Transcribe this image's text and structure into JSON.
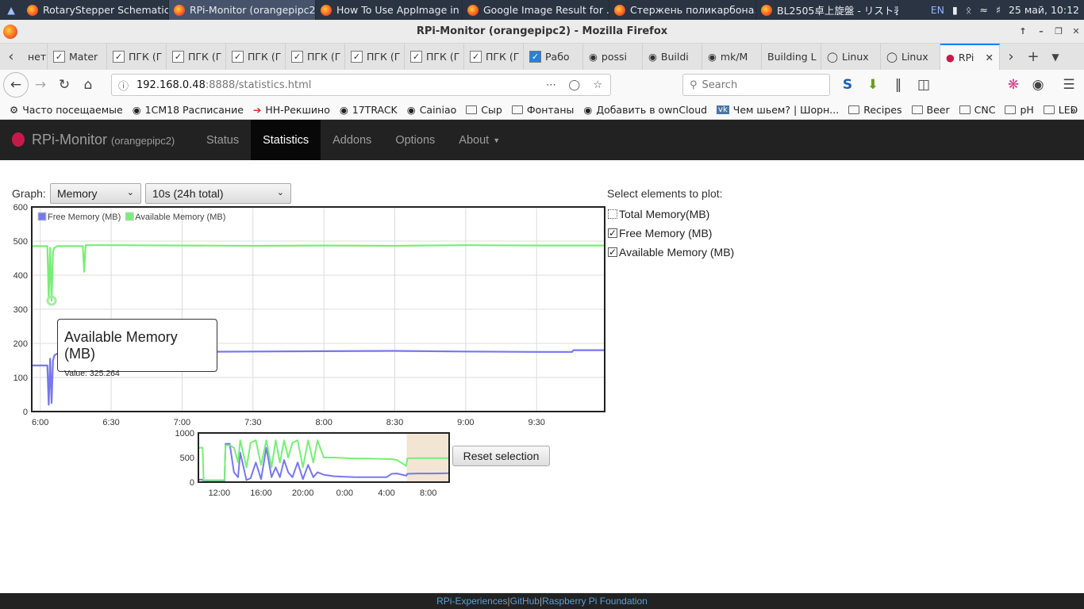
{
  "taskbar": {
    "tasks": [
      {
        "label": "RotaryStepper Schematic...."
      },
      {
        "label": "RPi-Monitor (orangepipc2..."
      },
      {
        "label": "How To Use AppImage in ..."
      },
      {
        "label": "Google Image Result for ..."
      },
      {
        "label": "Стержень поликарбона..."
      },
      {
        "label": "BL2505卓上旋盤 - リスト表..."
      }
    ],
    "lang": "EN",
    "clock": "25 май, 10:12"
  },
  "window": {
    "title": "RPi-Monitor (orangepipc2) - Mozilla Firefox"
  },
  "tabs": [
    {
      "label": "нет"
    },
    {
      "label": "Mater"
    },
    {
      "label": "ПГК (Г"
    },
    {
      "label": "ПГК (Г"
    },
    {
      "label": "ПГК (Г"
    },
    {
      "label": "ПГК (Г"
    },
    {
      "label": "ПГК (Г"
    },
    {
      "label": "ПГК (Г"
    },
    {
      "label": "ПГК (Г"
    },
    {
      "label": "Рабо"
    },
    {
      "label": "possi"
    },
    {
      "label": "Buildi"
    },
    {
      "label": "mk/M"
    },
    {
      "label": "Building L"
    },
    {
      "label": "Linux"
    },
    {
      "label": "Linux"
    },
    {
      "label": "RPi"
    }
  ],
  "navbar": {
    "url_host": "192.168.0.48",
    "url_rest": ":8888/statistics.html",
    "search_placeholder": "Search"
  },
  "bookmarks": [
    {
      "label": "Часто посещаемые"
    },
    {
      "label": "1CM18 Расписание"
    },
    {
      "label": "НН-Рекшино"
    },
    {
      "label": "17TRACK"
    },
    {
      "label": "Cainiao"
    },
    {
      "label": "Сыр"
    },
    {
      "label": "Фонтаны"
    },
    {
      "label": "Добавить в ownCloud"
    },
    {
      "label": "Чем шьем? | Шорн..."
    },
    {
      "label": "Recipes"
    },
    {
      "label": "Beer"
    },
    {
      "label": "CNC"
    },
    {
      "label": "pH"
    },
    {
      "label": "LED"
    }
  ],
  "app": {
    "brand": "RPi-Monitor",
    "host": "(orangepipc2)",
    "nav": [
      "Status",
      "Statistics",
      "Addons",
      "Options",
      "About"
    ]
  },
  "controls": {
    "graph_label": "Graph:",
    "graph_select": "Memory",
    "interval_select": "10s (24h total)",
    "select_title": "Select elements to plot:",
    "elements": [
      {
        "label": "Total Memory(MB)",
        "checked": false
      },
      {
        "label": "Free Memory (MB)",
        "checked": true
      },
      {
        "label": "Available Memory (MB)",
        "checked": true
      }
    ],
    "reset_label": "Reset selection"
  },
  "tooltip": {
    "title": "Available Memory (MB)",
    "value": "Value: 325.264"
  },
  "chart_data": [
    {
      "type": "line",
      "legend": "top-left",
      "grid": true,
      "xlim": [
        5.94,
        9.98
      ],
      "ylim": [
        0,
        600
      ],
      "yticks": [
        0,
        100,
        200,
        300,
        400,
        500,
        600
      ],
      "xticks": [
        {
          "v": 6.0,
          "label": "6:00"
        },
        {
          "v": 6.5,
          "label": "6:30"
        },
        {
          "v": 7.0,
          "label": "7:00"
        },
        {
          "v": 7.5,
          "label": "7:30"
        },
        {
          "v": 8.0,
          "label": "8:00"
        },
        {
          "v": 8.5,
          "label": "8:30"
        },
        {
          "v": 9.0,
          "label": "9:00"
        },
        {
          "v": 9.5,
          "label": "9:30"
        }
      ],
      "highlight": {
        "series": "Available Memory (MB)",
        "x": 6.08,
        "y": 325.264
      },
      "series": [
        {
          "name": "Free Memory (MB)",
          "color": "#7777ee",
          "x": [
            5.94,
            6.05,
            6.06,
            6.07,
            6.08,
            6.09,
            6.1,
            6.12,
            6.2,
            6.5,
            7.0,
            7.5,
            8.0,
            8.5,
            9.0,
            9.5,
            9.75,
            9.76,
            9.98
          ],
          "y": [
            135,
            135,
            20,
            155,
            25,
            150,
            165,
            170,
            172,
            174,
            175,
            176,
            177,
            178,
            176,
            175,
            175,
            180,
            180
          ]
        },
        {
          "name": "Available Memory (MB)",
          "color": "#77ee77",
          "x": [
            5.94,
            6.05,
            6.06,
            6.07,
            6.08,
            6.09,
            6.1,
            6.12,
            6.3,
            6.31,
            6.32,
            6.5,
            7.0,
            7.5,
            8.0,
            8.5,
            9.0,
            9.5,
            9.98
          ],
          "y": [
            485,
            485,
            330,
            480,
            325,
            470,
            480,
            485,
            485,
            410,
            488,
            488,
            487,
            486,
            487,
            486,
            488,
            487,
            487
          ]
        }
      ]
    },
    {
      "type": "line",
      "grid": false,
      "xlim": [
        10.0,
        34.0
      ],
      "ylim": [
        0,
        1000
      ],
      "yticks": [
        0,
        500,
        1000
      ],
      "xticks": [
        {
          "v": 12,
          "label": "12:00"
        },
        {
          "v": 16,
          "label": "16:00"
        },
        {
          "v": 20,
          "label": "20:00"
        },
        {
          "v": 24,
          "label": "0:00"
        },
        {
          "v": 28,
          "label": "4:00"
        },
        {
          "v": 32,
          "label": "8:00"
        }
      ],
      "selection": [
        29.94,
        33.98
      ],
      "series": [
        {
          "name": "Free Memory (MB)",
          "color": "#7777ee",
          "x": [
            10.0,
            10.4,
            10.5,
            12.5,
            12.6,
            13.0,
            13.4,
            13.8,
            14.0,
            14.6,
            15.0,
            15.5,
            16.0,
            16.5,
            17.0,
            17.4,
            17.8,
            18.2,
            18.6,
            19.0,
            19.5,
            20.0,
            20.5,
            21.0,
            21.4,
            22.0,
            23.0,
            24.0,
            25.0,
            26.0,
            27.0,
            28.0,
            28.5,
            29.0,
            29.9,
            30.0,
            31.0,
            32.0,
            33.0,
            34.0
          ],
          "y": [
            50,
            50,
            20,
            20,
            780,
            780,
            200,
            100,
            600,
            40,
            80,
            400,
            60,
            700,
            100,
            300,
            100,
            450,
            200,
            100,
            400,
            60,
            350,
            100,
            200,
            150,
            120,
            110,
            100,
            100,
            100,
            100,
            170,
            175,
            130,
            170,
            175,
            176,
            178,
            180
          ]
        },
        {
          "name": "Available Memory (MB)",
          "color": "#77ee77",
          "x": [
            10.0,
            10.4,
            10.5,
            12.5,
            12.6,
            13.0,
            13.4,
            13.8,
            14.0,
            14.6,
            15.0,
            15.5,
            16.0,
            16.5,
            17.0,
            17.4,
            17.8,
            18.2,
            18.6,
            19.0,
            19.5,
            20.0,
            20.5,
            21.0,
            21.4,
            22.0,
            23.0,
            24.0,
            25.0,
            26.0,
            27.0,
            28.0,
            28.5,
            29.0,
            29.9,
            30.0,
            31.0,
            32.0,
            33.0,
            34.0
          ],
          "y": [
            700,
            700,
            40,
            40,
            750,
            750,
            700,
            400,
            850,
            300,
            800,
            850,
            350,
            850,
            300,
            850,
            400,
            850,
            500,
            800,
            850,
            300,
            850,
            400,
            850,
            500,
            500,
            490,
            480,
            480,
            475,
            470,
            470,
            450,
            330,
            485,
            487,
            488,
            487,
            487
          ]
        }
      ]
    }
  ],
  "footer": {
    "link1": "RPi-Experiences",
    "sep": " | ",
    "link2": "GitHub",
    "link3": "Raspberry Pi Foundation"
  }
}
